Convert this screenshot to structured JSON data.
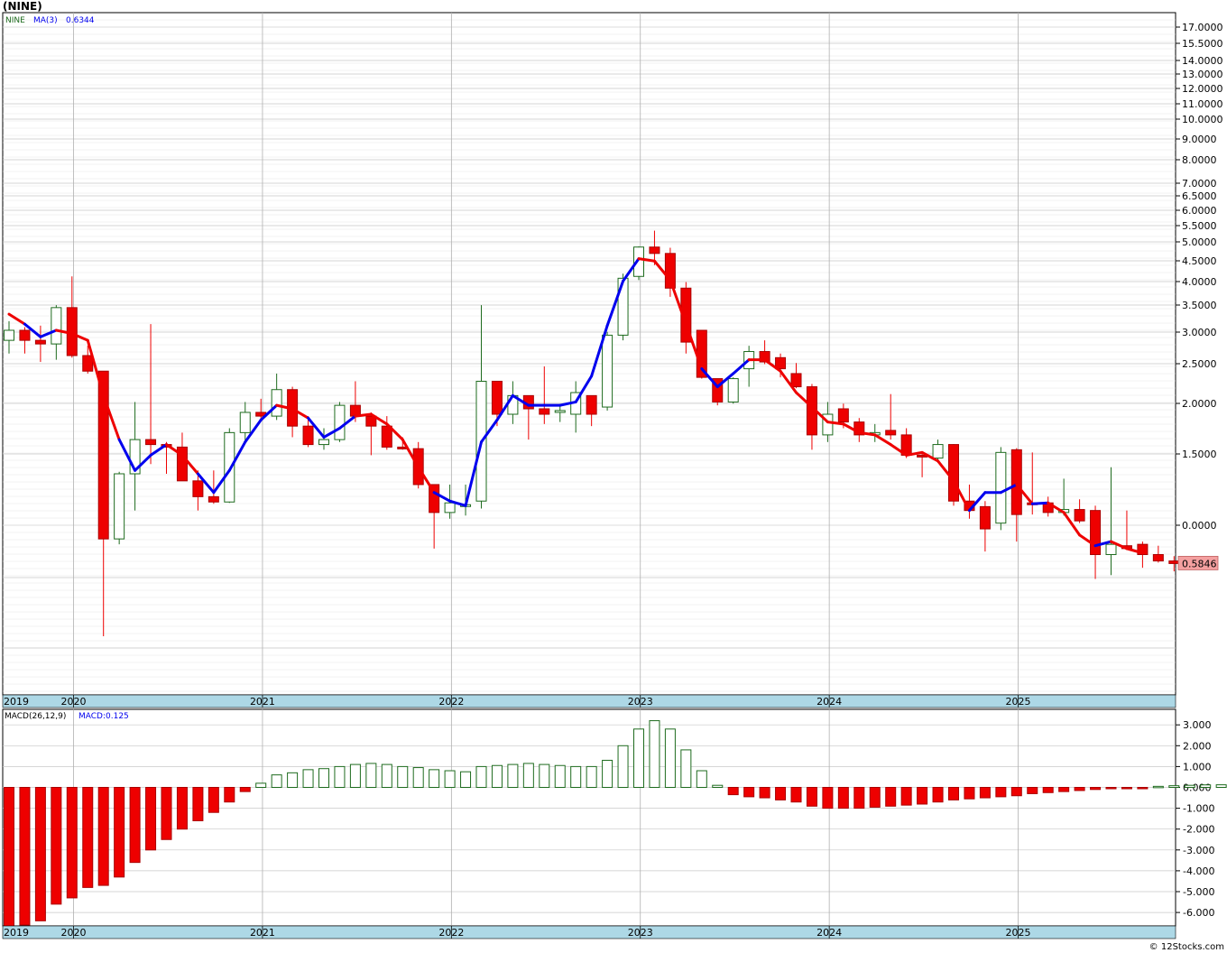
{
  "header": {
    "ticker": "(NINE)"
  },
  "footer": {
    "credit": "© 12Stocks.com"
  },
  "colors": {
    "up": "#1e6b1e",
    "down": "#ee0000",
    "ma_up": "#0000ee",
    "ma_down": "#ee0000",
    "axis_band": "#add8e6",
    "grid": "#c8c8c8",
    "last_price_bg": "#f4a0a0"
  },
  "chart_data": [
    {
      "type": "candlestick",
      "scale": "log",
      "legend": {
        "symbol": "NINE",
        "ma_label": "MA(3)",
        "ma_value": "0.6344"
      },
      "last_price_label": "0.5846",
      "y_tick_labels": [
        "17.0000",
        "15.5000",
        "14.0000",
        "13.0000",
        "12.0000",
        "11.0000",
        "10.0000",
        "9.0000",
        "8.0000",
        "7.0000",
        "6.5000",
        "6.0000",
        "5.5000",
        "5.0000",
        "4.5000",
        "4.0000",
        "3.5000",
        "3.0000",
        "2.5000",
        "2.0000",
        "1.5000",
        "0.0000"
      ],
      "year_labels": [
        "2019",
        "2020",
        "2021",
        "2022",
        "2023",
        "2024",
        "2025"
      ],
      "candles": [
        {
          "d": "2019-06",
          "o": 5.6,
          "h": 6.8,
          "l": 4.9,
          "c": 6.2
        },
        {
          "d": "2019-07",
          "o": 6.2,
          "h": 6.4,
          "l": 4.9,
          "c": 5.6
        },
        {
          "d": "2019-08",
          "o": 5.6,
          "h": 6.5,
          "l": 4.5,
          "c": 5.4
        },
        {
          "d": "2019-09",
          "o": 5.4,
          "h": 8.0,
          "l": 4.6,
          "c": 7.8
        },
        {
          "d": "2019-10",
          "o": 7.8,
          "h": 10.7,
          "l": 4.7,
          "c": 4.8
        },
        {
          "d": "2019-11",
          "o": 4.8,
          "h": 5.3,
          "l": 4.0,
          "c": 4.1
        },
        {
          "d": "2019-12",
          "o": 4.1,
          "h": 4.1,
          "l": 0.28,
          "c": 0.75
        },
        {
          "d": "2020-01",
          "o": 0.75,
          "h": 1.48,
          "l": 0.71,
          "c": 1.45
        },
        {
          "d": "2020-02",
          "o": 1.45,
          "h": 3.0,
          "l": 1.0,
          "c": 2.05
        },
        {
          "d": "2020-03",
          "o": 2.05,
          "h": 6.6,
          "l": 1.6,
          "c": 1.95
        },
        {
          "d": "2020-04",
          "o": 1.95,
          "h": 2.0,
          "l": 1.45,
          "c": 1.9
        },
        {
          "d": "2020-05",
          "o": 1.9,
          "h": 2.2,
          "l": 1.35,
          "c": 1.35
        },
        {
          "d": "2020-06",
          "o": 1.35,
          "h": 1.5,
          "l": 1.0,
          "c": 1.15
        },
        {
          "d": "2020-07",
          "o": 1.15,
          "h": 1.5,
          "l": 1.07,
          "c": 1.09
        },
        {
          "d": "2020-08",
          "o": 1.09,
          "h": 2.3,
          "l": 1.08,
          "c": 2.2
        },
        {
          "d": "2020-09",
          "o": 2.2,
          "h": 3.0,
          "l": 2.0,
          "c": 2.7
        },
        {
          "d": "2020-10",
          "o": 2.7,
          "h": 3.1,
          "l": 2.5,
          "c": 2.6
        },
        {
          "d": "2020-11",
          "o": 2.6,
          "h": 4.0,
          "l": 2.5,
          "c": 3.4
        },
        {
          "d": "2020-12",
          "o": 3.4,
          "h": 3.5,
          "l": 2.1,
          "c": 2.35
        },
        {
          "d": "2021-01",
          "o": 2.35,
          "h": 2.6,
          "l": 1.9,
          "c": 1.95
        },
        {
          "d": "2021-02",
          "o": 1.95,
          "h": 2.3,
          "l": 1.85,
          "c": 2.05
        },
        {
          "d": "2021-03",
          "o": 2.05,
          "h": 3.0,
          "l": 2.0,
          "c": 2.9
        },
        {
          "d": "2021-04",
          "o": 2.9,
          "h": 3.7,
          "l": 2.45,
          "c": 2.6
        },
        {
          "d": "2021-05",
          "o": 2.6,
          "h": 2.7,
          "l": 1.75,
          "c": 2.35
        },
        {
          "d": "2021-06",
          "o": 2.35,
          "h": 2.6,
          "l": 1.85,
          "c": 1.9
        },
        {
          "d": "2021-07",
          "o": 1.9,
          "h": 2.1,
          "l": 1.85,
          "c": 1.87
        },
        {
          "d": "2021-08",
          "o": 1.87,
          "h": 2.0,
          "l": 1.25,
          "c": 1.3
        },
        {
          "d": "2021-09",
          "o": 1.3,
          "h": 1.3,
          "l": 0.68,
          "c": 0.98
        },
        {
          "d": "2021-10",
          "o": 0.98,
          "h": 1.3,
          "l": 0.92,
          "c": 1.08
        },
        {
          "d": "2021-11",
          "o": 1.05,
          "h": 1.3,
          "l": 0.95,
          "c": 1.06
        },
        {
          "d": "2021-12",
          "o": 1.1,
          "h": 8.0,
          "l": 1.02,
          "c": 3.7
        },
        {
          "d": "2022-01",
          "o": 3.7,
          "h": 3.7,
          "l": 2.35,
          "c": 2.65
        },
        {
          "d": "2022-02",
          "o": 2.65,
          "h": 3.7,
          "l": 2.4,
          "c": 3.2
        },
        {
          "d": "2022-03",
          "o": 3.2,
          "h": 3.2,
          "l": 2.05,
          "c": 2.8
        },
        {
          "d": "2022-04",
          "o": 2.8,
          "h": 4.3,
          "l": 2.4,
          "c": 2.65
        },
        {
          "d": "2022-05",
          "o": 2.75,
          "h": 2.9,
          "l": 2.45,
          "c": 2.75
        },
        {
          "d": "2022-06",
          "o": 2.65,
          "h": 3.7,
          "l": 2.2,
          "c": 3.3
        },
        {
          "d": "2022-07",
          "o": 3.2,
          "h": 3.2,
          "l": 2.35,
          "c": 2.65
        },
        {
          "d": "2022-08",
          "o": 2.85,
          "h": 6.1,
          "l": 2.75,
          "c": 5.9
        },
        {
          "d": "2022-09",
          "o": 5.9,
          "h": 11.0,
          "l": 5.6,
          "c": 10.5
        },
        {
          "d": "2022-10",
          "o": 10.7,
          "h": 14.5,
          "l": 10.3,
          "c": 14.4
        },
        {
          "d": "2022-11",
          "o": 14.4,
          "h": 17.0,
          "l": 12.0,
          "c": 13.5
        },
        {
          "d": "2022-12",
          "o": 13.5,
          "h": 14.3,
          "l": 8.7,
          "c": 9.5
        },
        {
          "d": "2023-01",
          "o": 9.5,
          "h": 10.1,
          "l": 4.9,
          "c": 5.5
        },
        {
          "d": "2023-02",
          "o": 6.2,
          "h": 6.2,
          "l": 3.8,
          "c": 3.85
        },
        {
          "d": "2023-03",
          "o": 3.8,
          "h": 3.8,
          "l": 2.9,
          "c": 3.0
        },
        {
          "d": "2023-04",
          "o": 3.0,
          "h": 3.85,
          "l": 2.95,
          "c": 3.8
        },
        {
          "d": "2023-05",
          "o": 4.2,
          "h": 5.3,
          "l": 3.5,
          "c": 5.0
        },
        {
          "d": "2023-06",
          "o": 5.0,
          "h": 5.6,
          "l": 4.4,
          "c": 4.5
        },
        {
          "d": "2023-07",
          "o": 4.7,
          "h": 4.9,
          "l": 3.85,
          "c": 4.2
        },
        {
          "d": "2023-08",
          "o": 4.0,
          "h": 4.45,
          "l": 3.45,
          "c": 3.5
        },
        {
          "d": "2023-09",
          "o": 3.5,
          "h": 3.6,
          "l": 1.85,
          "c": 2.15
        },
        {
          "d": "2023-10",
          "o": 2.15,
          "h": 3.0,
          "l": 2.0,
          "c": 2.65
        },
        {
          "d": "2023-11",
          "o": 2.8,
          "h": 2.95,
          "l": 2.3,
          "c": 2.45
        },
        {
          "d": "2023-12",
          "o": 2.45,
          "h": 2.55,
          "l": 2.0,
          "c": 2.15
        },
        {
          "d": "2024-01",
          "o": 2.15,
          "h": 2.4,
          "l": 2.0,
          "c": 2.2
        },
        {
          "d": "2024-02",
          "o": 2.25,
          "h": 3.25,
          "l": 2.05,
          "c": 2.15
        },
        {
          "d": "2024-03",
          "o": 2.15,
          "h": 2.3,
          "l": 1.7,
          "c": 1.75
        },
        {
          "d": "2024-04",
          "o": 1.75,
          "h": 1.8,
          "l": 1.4,
          "c": 1.72
        },
        {
          "d": "2024-05",
          "o": 1.7,
          "h": 2.05,
          "l": 1.62,
          "c": 1.95
        },
        {
          "d": "2024-06",
          "o": 1.95,
          "h": 1.96,
          "l": 1.05,
          "c": 1.1
        },
        {
          "d": "2024-07",
          "o": 1.1,
          "h": 1.3,
          "l": 0.92,
          "c": 1.0
        },
        {
          "d": "2024-08",
          "o": 1.04,
          "h": 1.1,
          "l": 0.66,
          "c": 0.83
        },
        {
          "d": "2024-09",
          "o": 0.88,
          "h": 1.9,
          "l": 0.82,
          "c": 1.8
        },
        {
          "d": "2024-10",
          "o": 1.85,
          "h": 1.88,
          "l": 0.73,
          "c": 0.96
        },
        {
          "d": "2024-11",
          "o": 1.08,
          "h": 1.8,
          "l": 0.96,
          "c": 1.07
        },
        {
          "d": "2024-12",
          "o": 1.08,
          "h": 1.15,
          "l": 0.94,
          "c": 0.98
        },
        {
          "d": "2025-01",
          "o": 0.98,
          "h": 1.38,
          "l": 0.95,
          "c": 1.01
        },
        {
          "d": "2025-02",
          "o": 1.01,
          "h": 1.12,
          "l": 0.88,
          "c": 0.9
        },
        {
          "d": "2025-03",
          "o": 1.0,
          "h": 1.05,
          "l": 0.5,
          "c": 0.64
        },
        {
          "d": "2025-04",
          "o": 0.64,
          "h": 1.55,
          "l": 0.52,
          "c": 0.71
        },
        {
          "d": "2025-05",
          "o": 0.7,
          "h": 1.0,
          "l": 0.67,
          "c": 0.68
        },
        {
          "d": "2025-06",
          "o": 0.71,
          "h": 0.73,
          "l": 0.56,
          "c": 0.64
        },
        {
          "d": "2025-07",
          "o": 0.64,
          "h": 0.7,
          "l": 0.59,
          "c": 0.6
        },
        {
          "d": "2025-08",
          "o": 0.6,
          "h": 0.63,
          "l": 0.54,
          "c": 0.5846
        }
      ],
      "ma": [
        7.3,
        6.6,
        5.8,
        6.2,
        6.0,
        5.6,
        3.2,
        2.05,
        1.5,
        1.75,
        1.95,
        1.75,
        1.45,
        1.2,
        1.5,
        2.0,
        2.5,
        2.9,
        2.8,
        2.55,
        2.1,
        2.3,
        2.6,
        2.65,
        2.4,
        2.05,
        1.55,
        1.2,
        1.1,
        1.05,
        2.0,
        2.5,
        3.2,
        2.9,
        2.9,
        2.9,
        3.0,
        3.9,
        6.5,
        10.2,
        12.8,
        12.5,
        10.3,
        6.6,
        4.2,
        3.5,
        4.0,
        4.6,
        4.6,
        4.1,
        3.3,
        2.85,
        2.45,
        2.4,
        2.2,
        2.15,
        1.95,
        1.75,
        1.8,
        1.65,
        1.35,
        1.0,
        1.2,
        1.2,
        1.3,
        1.07,
        1.08,
        0.98,
        0.78,
        0.7,
        0.73,
        0.68,
        0.65
      ],
      "ma_color": [
        "r",
        "r",
        "b",
        "b",
        "r",
        "r",
        "r",
        "r",
        "b",
        "b",
        "b",
        "r",
        "r",
        "b",
        "b",
        "b",
        "b",
        "b",
        "r",
        "r",
        "b",
        "b",
        "b",
        "r",
        "r",
        "r",
        "r",
        "r",
        "b",
        "b",
        "b",
        "b",
        "b",
        "b",
        "b",
        "b",
        "b",
        "b",
        "b",
        "b",
        "b",
        "r",
        "r",
        "r",
        "r",
        "b",
        "b",
        "b",
        "r",
        "r",
        "r",
        "r",
        "r",
        "r",
        "r",
        "r",
        "r",
        "r",
        "r",
        "r",
        "r",
        "r",
        "b",
        "b",
        "b",
        "r",
        "b",
        "r",
        "r",
        "r",
        "b",
        "r",
        "r"
      ]
    },
    {
      "type": "bar",
      "legend": {
        "label": "MACD(26,12,9)",
        "value_label": "MACD:0.125"
      },
      "y_tick_labels": [
        "3.000",
        "2.000",
        "1.000",
        "0.000",
        "-1.000",
        "-2.000",
        "-3.000",
        "-4.000",
        "-5.000",
        "-6.000"
      ],
      "ylim": [
        -6.7,
        3.4
      ],
      "year_labels": [
        "2019",
        "2020",
        "2021",
        "2022",
        "2023",
        "2024",
        "2025"
      ],
      "values": [
        -6.7,
        -6.6,
        -6.4,
        -5.6,
        -5.3,
        -4.8,
        -4.7,
        -4.3,
        -3.6,
        -3.0,
        -2.5,
        -2.0,
        -1.6,
        -1.2,
        -0.7,
        -0.2,
        0.2,
        0.6,
        0.7,
        0.85,
        0.9,
        1.0,
        1.1,
        1.15,
        1.1,
        1.0,
        0.95,
        0.85,
        0.8,
        0.75,
        1.0,
        1.05,
        1.1,
        1.15,
        1.1,
        1.05,
        1.0,
        1.0,
        1.3,
        2.0,
        2.8,
        3.2,
        2.8,
        1.8,
        0.8,
        0.1,
        -0.35,
        -0.45,
        -0.5,
        -0.6,
        -0.7,
        -0.9,
        -1.0,
        -1.0,
        -1.0,
        -0.95,
        -0.9,
        -0.85,
        -0.8,
        -0.7,
        -0.6,
        -0.55,
        -0.5,
        -0.45,
        -0.4,
        -0.3,
        -0.25,
        -0.2,
        -0.15,
        -0.1,
        -0.05,
        -0.03,
        -0.02,
        0.05,
        0.08,
        0.1,
        0.12,
        0.125
      ]
    }
  ]
}
